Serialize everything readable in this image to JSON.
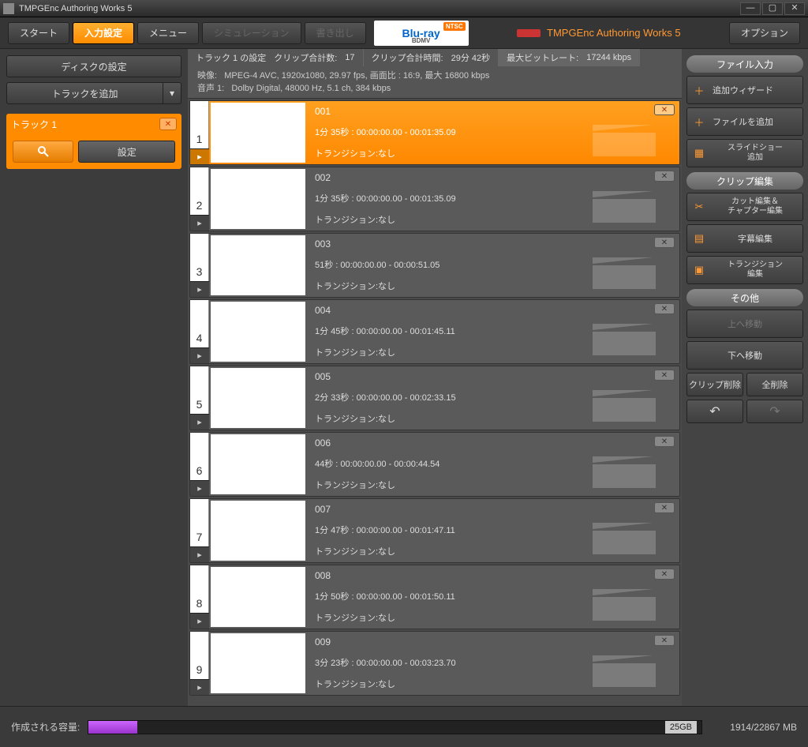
{
  "window": {
    "title": "TMPGEnc Authoring Works 5"
  },
  "toolbar": {
    "start": "スタート",
    "input": "入力設定",
    "menu": "メニュー",
    "simulation": "シミュレーション",
    "export": "書き出し",
    "bluray": "Blu-ray",
    "bdmv": "BDMV",
    "ntsc": "NTSC",
    "brand": "TMPGEnc Authoring Works 5",
    "option": "オプション"
  },
  "left": {
    "disc_settings": "ディスクの設定",
    "add_track": "トラックを追加",
    "track1": "トラック 1",
    "settings": "設定"
  },
  "info": {
    "track_label": "トラック 1 の設定",
    "clip_count_label": "クリップ合計数:",
    "clip_count": "17",
    "clip_time_label": "クリップ合計時間:",
    "clip_time": "29分 42秒",
    "bitrate_label": "最大ビットレート:",
    "bitrate": "17244 kbps",
    "video_label": "映像:",
    "video": "MPEG-4 AVC, 1920x1080, 29.97 fps, 画面比 : 16:9, 最大 16800 kbps",
    "audio_label": "音声 1:",
    "audio": "Dolby Digital, 48000 Hz, 5.1 ch, 384 kbps"
  },
  "clips": [
    {
      "num": "1",
      "title": "001",
      "duration": "1分 35秒 : 00:00:00.00 - 00:01:35.09",
      "transition": "トランジション:なし",
      "active": true
    },
    {
      "num": "2",
      "title": "002",
      "duration": "1分 35秒 : 00:00:00.00 - 00:01:35.09",
      "transition": "トランジション:なし",
      "active": false
    },
    {
      "num": "3",
      "title": "003",
      "duration": "51秒 : 00:00:00.00 - 00:00:51.05",
      "transition": "トランジション:なし",
      "active": false
    },
    {
      "num": "4",
      "title": "004",
      "duration": "1分 45秒 : 00:00:00.00 - 00:01:45.11",
      "transition": "トランジション:なし",
      "active": false
    },
    {
      "num": "5",
      "title": "005",
      "duration": "2分 33秒 : 00:00:00.00 - 00:02:33.15",
      "transition": "トランジション:なし",
      "active": false
    },
    {
      "num": "6",
      "title": "006",
      "duration": "44秒 : 00:00:00.00 - 00:00:44.54",
      "transition": "トランジション:なし",
      "active": false
    },
    {
      "num": "7",
      "title": "007",
      "duration": "1分 47秒 : 00:00:00.00 - 00:01:47.11",
      "transition": "トランジション:なし",
      "active": false
    },
    {
      "num": "8",
      "title": "008",
      "duration": "1分 50秒 : 00:00:00.00 - 00:01:50.11",
      "transition": "トランジション:なし",
      "active": false
    },
    {
      "num": "9",
      "title": "009",
      "duration": "3分 23秒 : 00:00:00.00 - 00:03:23.70",
      "transition": "トランジション:なし",
      "active": false
    }
  ],
  "right": {
    "file_input": "ファイル入力",
    "add_wizard": "追加ウィザード",
    "add_file": "ファイルを追加",
    "add_slideshow": "スライドショー\n追加",
    "clip_edit": "クリップ編集",
    "cut_chapter": "カット編集＆\nチャプター編集",
    "subtitle": "字幕編集",
    "transition": "トランジション\n編集",
    "other": "その他",
    "move_up": "上へ移動",
    "move_down": "下へ移動",
    "clip_delete": "クリップ削除",
    "all_delete": "全削除"
  },
  "status": {
    "label": "作成される容量:",
    "cap": "25GB",
    "mb": "1914/22867 MB"
  }
}
